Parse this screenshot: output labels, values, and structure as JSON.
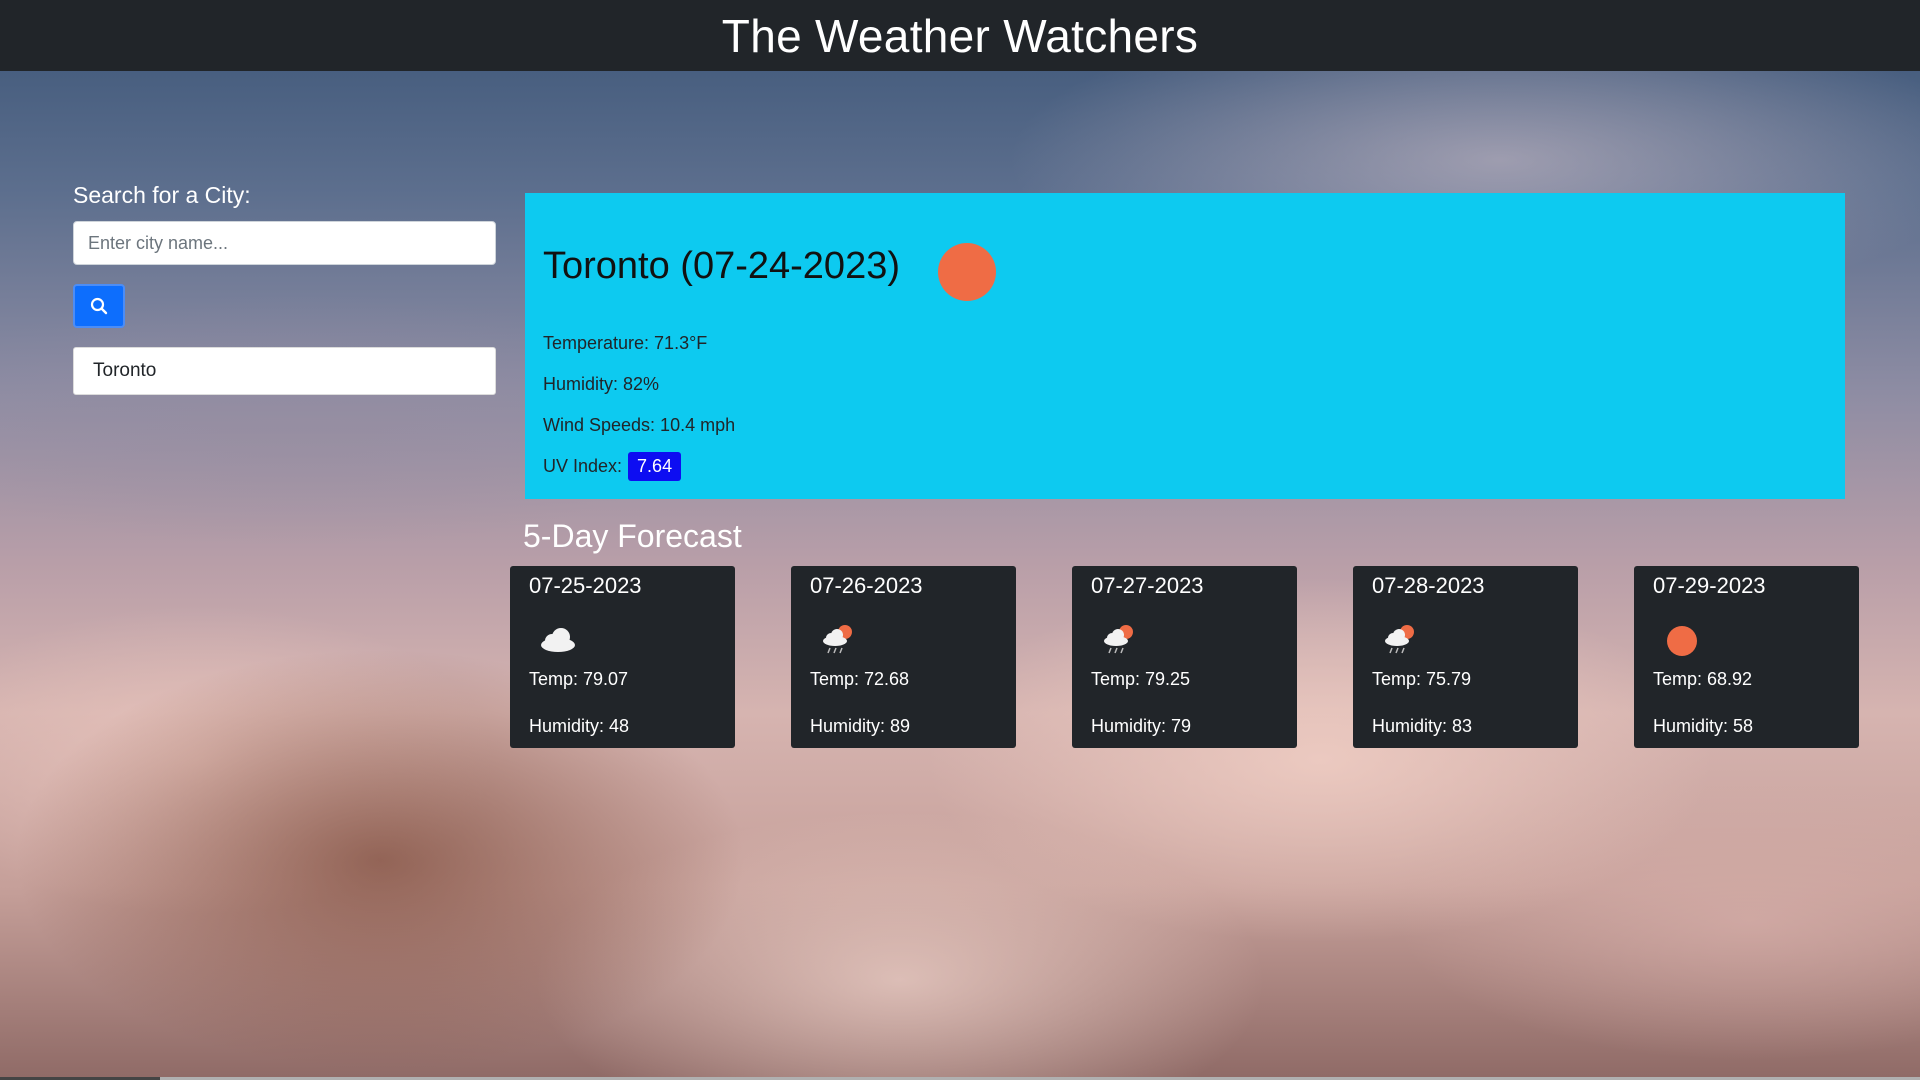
{
  "header": {
    "title": "The Weather Watchers"
  },
  "search": {
    "label": "Search for a City:",
    "placeholder": "Enter city name...",
    "button_icon": "search-icon"
  },
  "history": [
    {
      "label": "Toronto"
    }
  ],
  "current": {
    "city_date": "Toronto (07-24-2023)",
    "icon": "sun-icon",
    "temperature": "Temperature: 71.3°F",
    "humidity": "Humidity: 82%",
    "wind": "Wind Speeds: 10.4 mph",
    "uv_label": "UV Index:",
    "uv_value": "7.64",
    "uv_color": "#0d0df2"
  },
  "forecast": {
    "title": "5-Day Forecast",
    "days": [
      {
        "date": "07-25-2023",
        "icon": "cloud-icon",
        "temp": "Temp: 79.07",
        "humidity": "Humidity: 48"
      },
      {
        "date": "07-26-2023",
        "icon": "rain-sun-icon",
        "temp": "Temp: 72.68",
        "humidity": "Humidity: 89"
      },
      {
        "date": "07-27-2023",
        "icon": "rain-sun-icon",
        "temp": "Temp: 79.25",
        "humidity": "Humidity: 79"
      },
      {
        "date": "07-28-2023",
        "icon": "rain-sun-icon",
        "temp": "Temp: 75.79",
        "humidity": "Humidity: 83"
      },
      {
        "date": "07-29-2023",
        "icon": "sun-icon",
        "temp": "Temp: 68.92",
        "humidity": "Humidity: 58"
      }
    ]
  },
  "colors": {
    "header_bg": "#212529",
    "current_bg": "#0dcaf0",
    "button_bg": "#0d6efd",
    "card_bg": "#212529",
    "sun": "#ef6c45"
  }
}
